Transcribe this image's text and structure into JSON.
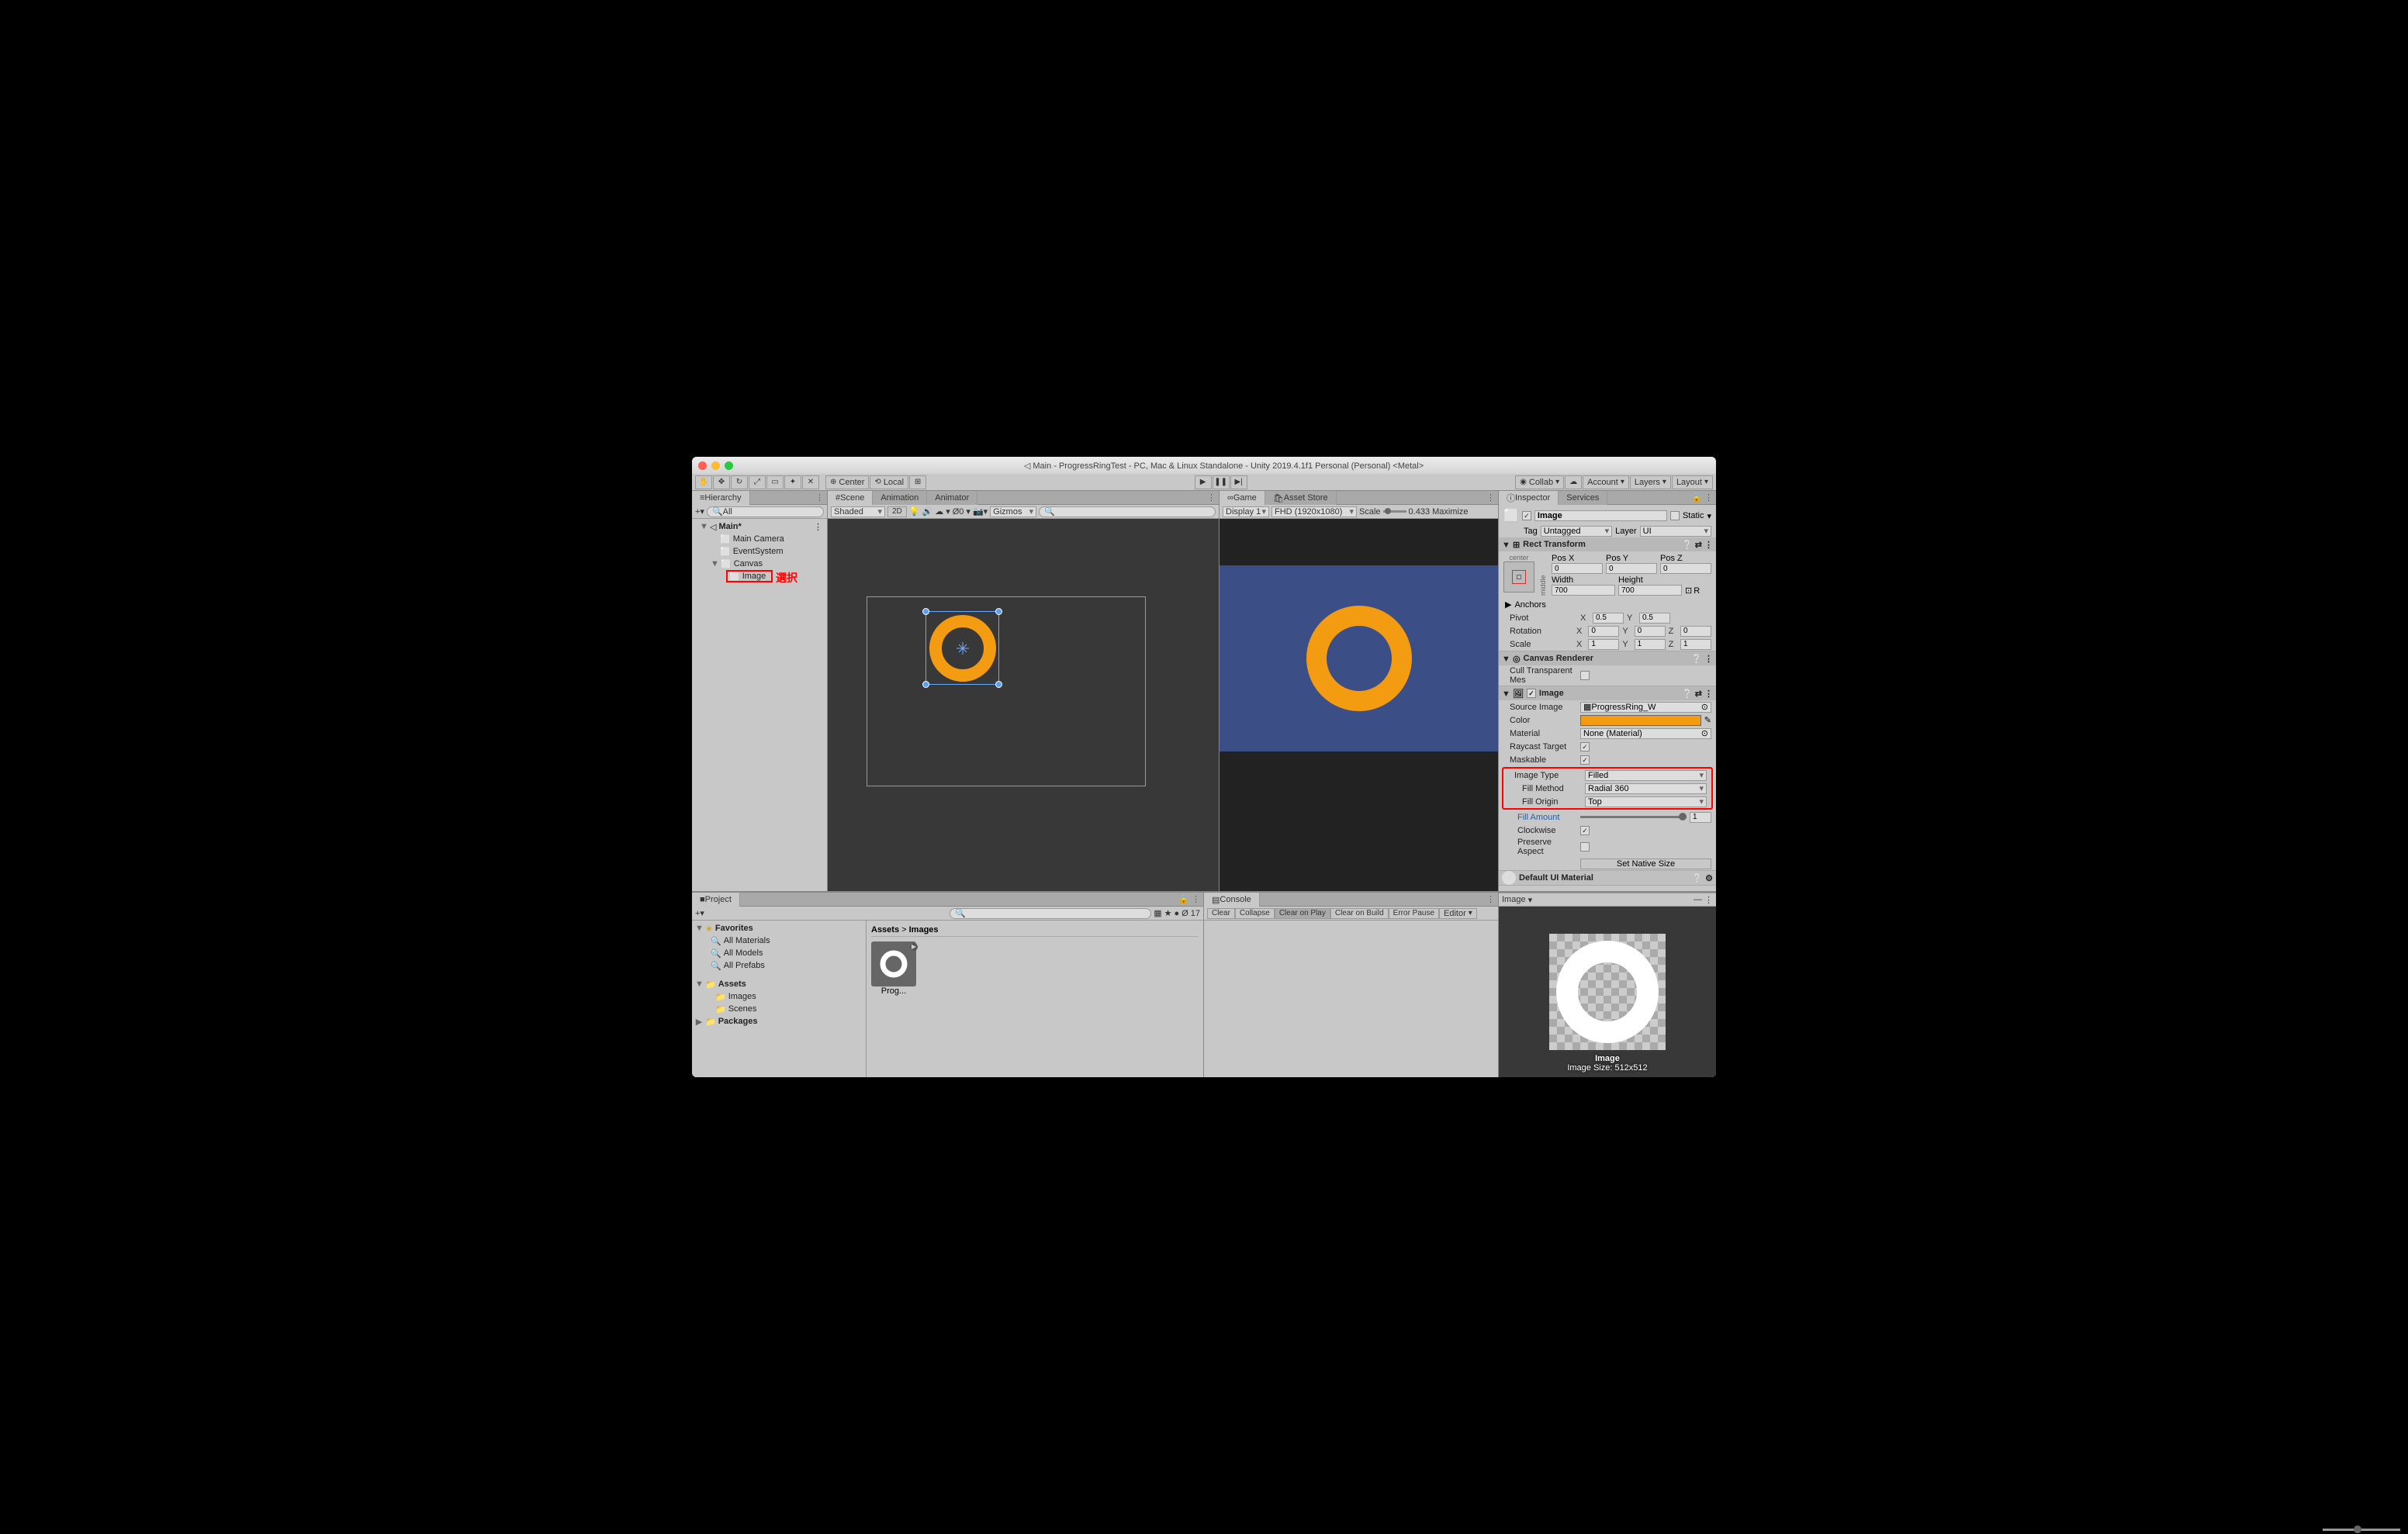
{
  "titlebar": {
    "title": "◁ Main - ProgressRingTest - PC, Mac & Linux Standalone - Unity 2019.4.1f1 Personal (Personal) <Metal>"
  },
  "toolbar": {
    "center": "Center",
    "local": "Local",
    "collab": "Collab",
    "account": "Account",
    "layers": "Layers",
    "layout": "Layout"
  },
  "hierarchy": {
    "title": "Hierarchy",
    "search_placeholder": "All",
    "items": [
      "Main*",
      "Main Camera",
      "EventSystem",
      "Canvas",
      "Image"
    ],
    "annotation": "選択"
  },
  "scene": {
    "tab_scene": "Scene",
    "tab_animation": "Animation",
    "tab_animator": "Animator",
    "shaded": "Shaded",
    "twod": "2D",
    "gizmos": "Gizmos"
  },
  "game": {
    "tab_game": "Game",
    "tab_asset": "Asset Store",
    "display": "Display 1",
    "res": "FHD (1920x1080)",
    "scale_label": "Scale",
    "scale_val": "0.433",
    "maximize": "Maximize"
  },
  "inspector": {
    "tab_inspector": "Inspector",
    "tab_services": "Services",
    "name": "Image",
    "static": "Static",
    "tag_label": "Tag",
    "tag_val": "Untagged",
    "layer_label": "Layer",
    "layer_val": "UI",
    "rect": {
      "title": "Rect Transform",
      "center": "center",
      "middle": "middle",
      "posx": "Pos X",
      "posy": "Pos Y",
      "posz": "Pos Z",
      "px": "0",
      "py": "0",
      "pz": "0",
      "width": "Width",
      "height": "Height",
      "w": "700",
      "h": "700",
      "anchors": "Anchors",
      "pivot": "Pivot",
      "pvx": "0.5",
      "pvy": "0.5",
      "rotation": "Rotation",
      "rx": "0",
      "ry": "0",
      "rz": "0",
      "scale_label": "Scale",
      "sx": "1",
      "sy": "1",
      "sz": "1"
    },
    "canvas_renderer": {
      "title": "Canvas Renderer",
      "cull": "Cull Transparent Mes"
    },
    "image": {
      "title": "Image",
      "source": "Source Image",
      "source_val": "ProgressRing_W",
      "color": "Color",
      "material": "Material",
      "material_val": "None (Material)",
      "raycast": "Raycast Target",
      "maskable": "Maskable",
      "image_type": "Image Type",
      "image_type_val": "Filled",
      "fill_method": "Fill Method",
      "fill_method_val": "Radial 360",
      "fill_origin": "Fill Origin",
      "fill_origin_val": "Top",
      "fill_amount": "Fill Amount",
      "fill_amount_val": "1",
      "clockwise": "Clockwise",
      "preserve": "Preserve Aspect",
      "set_native": "Set Native Size"
    },
    "material_section": "Default UI Material",
    "preview_label": "Image",
    "preview_size": "Image Size: 512x512",
    "preview_tab": "Image"
  },
  "project": {
    "tab": "Project",
    "favorites": "Favorites",
    "all_mat": "All Materials",
    "all_mod": "All Models",
    "all_pre": "All Prefabs",
    "assets": "Assets",
    "images": "Images",
    "scenes": "Scenes",
    "packages": "Packages",
    "breadcrumb_a": "Assets",
    "breadcrumb_b": "Images",
    "thumb": "Prog...",
    "count": "17"
  },
  "console": {
    "tab": "Console",
    "clear": "Clear",
    "collapse": "Collapse",
    "clearplay": "Clear on Play",
    "clearbuild": "Clear on Build",
    "errorpause": "Error Pause",
    "editor": "Editor"
  }
}
